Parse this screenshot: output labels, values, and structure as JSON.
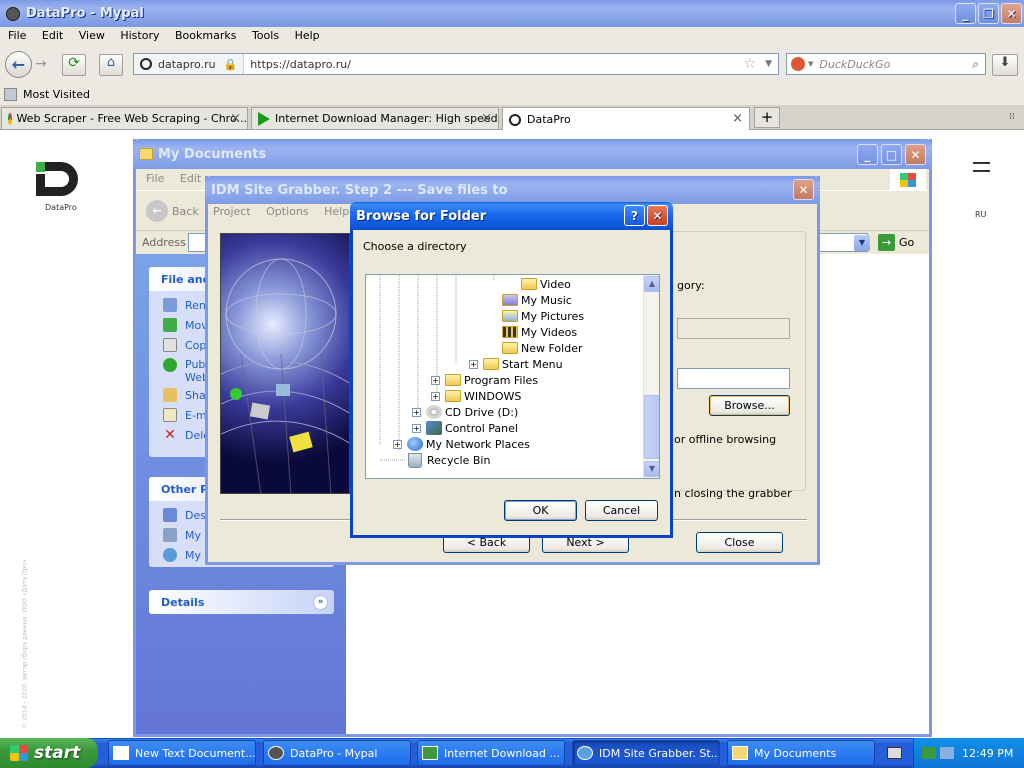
{
  "browser": {
    "title": "DataPro - Mypal",
    "menu": [
      "File",
      "Edit",
      "View",
      "History",
      "Bookmarks",
      "Tools",
      "Help"
    ],
    "identity": "datapro.ru",
    "url": "https://datapro.ru/",
    "search_placeholder": "DuckDuckGo",
    "bookmark": "Most Visited",
    "tabs": [
      {
        "label": "Web Scraper - Free Web Scraping - Chro..."
      },
      {
        "label": "Internet Download Manager: High speed ..."
      },
      {
        "label": "DataPro"
      }
    ]
  },
  "site": {
    "logo_text": "DataPro",
    "lang": "RU",
    "menu_icon": "hamburger-icon",
    "side_text": "© 2014 - 2020, автор сбора данных: ООО «Дата Про»"
  },
  "mydocs": {
    "title": "My Documents",
    "menu": [
      "File",
      "Edit"
    ],
    "back": "Back",
    "address_label": "Address",
    "go": "Go",
    "file_tasks_title": "File and",
    "file_tasks": [
      "Rena",
      "Mov",
      "Copy",
      "Publ",
      "Web",
      "Shar",
      "E-ma",
      "Dele"
    ],
    "other_places_title": "Other Pl",
    "other_places": [
      "Desk",
      "My C",
      "My N"
    ],
    "details_title": "Details"
  },
  "grabber": {
    "title": "IDM Site Grabber. Step 2 --- Save files to",
    "menu": [
      "Project",
      "Options",
      "Help"
    ],
    "category_text": "gory:",
    "browse": "Browse...",
    "offline_text": "or offline browsing",
    "closing_text": "n closing the grabber",
    "back": "< Back",
    "next": "Next >",
    "close": "Close"
  },
  "folder_dialog": {
    "title": "Browse for Folder",
    "prompt": "Choose a directory",
    "tree": [
      "Video",
      "My Music",
      "My Pictures",
      "My Videos",
      "New Folder",
      "Start Menu",
      "Program Files",
      "WINDOWS",
      "CD Drive (D:)",
      "Control Panel",
      "My Network Places",
      "Recycle Bin"
    ],
    "ok": "OK",
    "cancel": "Cancel"
  },
  "taskbar": {
    "start": "start",
    "items": [
      "New Text Document....",
      "DataPro - Mypal",
      "Internet Download ...",
      "IDM Site Grabber. St...",
      "My Documents"
    ],
    "clock": "12:49 PM"
  },
  "colors": {
    "xp_blue": "#245edb",
    "taskbar": "#245edb",
    "start_green": "#3c9a3c",
    "dialog_bg": "#ece9d8"
  }
}
